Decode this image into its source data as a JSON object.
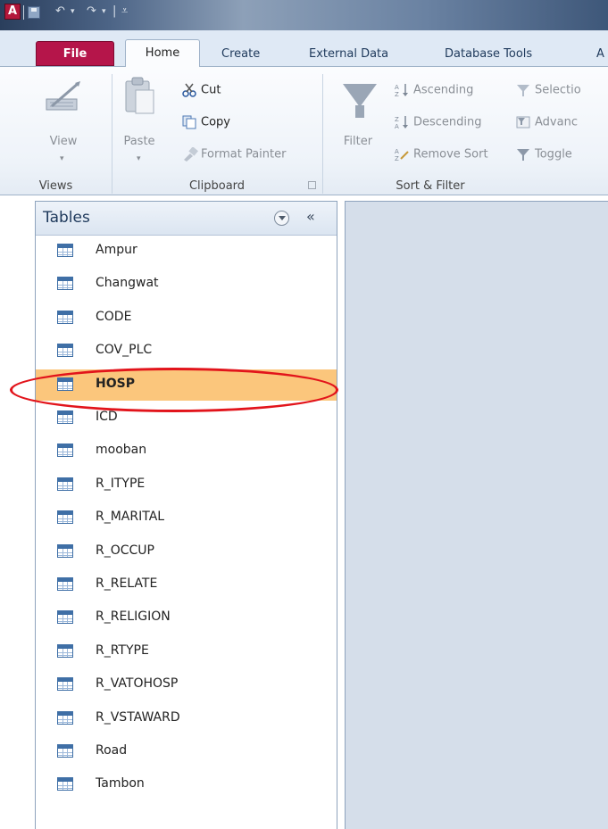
{
  "titlebar": {
    "app_logo": "A",
    "qat": [
      "↶",
      "▾",
      "↷",
      "▾",
      "|",
      "⩡"
    ]
  },
  "tabs": [
    {
      "id": "file",
      "label": "File"
    },
    {
      "id": "home",
      "label": "Home"
    },
    {
      "id": "create",
      "label": "Create"
    },
    {
      "id": "external",
      "label": "External Data"
    },
    {
      "id": "dbtools",
      "label": "Database Tools"
    },
    {
      "id": "more",
      "label": "A"
    }
  ],
  "ribbon": {
    "views": {
      "label": "Views",
      "view_button": "View"
    },
    "clipboard": {
      "label": "Clipboard",
      "paste": "Paste",
      "cut": "Cut",
      "copy": "Copy",
      "format_painter": "Format Painter"
    },
    "sort_filter": {
      "label": "Sort & Filter",
      "filter": "Filter",
      "ascending": "Ascending",
      "descending": "Descending",
      "remove_sort": "Remove Sort",
      "selection": "Selectio",
      "advanced": "Advanc",
      "toggle": "Toggle"
    }
  },
  "nav_pane": {
    "title": "Tables",
    "collapse_glyph": "«",
    "items": [
      "Ampur",
      "Changwat",
      "CODE",
      "COV_PLC",
      "HOSP",
      "ICD",
      "mooban",
      "R_ITYPE",
      "R_MARITAL",
      "R_OCCUP",
      "R_RELATE",
      "R_RELIGION",
      "R_RTYPE",
      "R_VATOHOSP",
      "R_VSTAWARD",
      "Road",
      "Tambon"
    ],
    "selected": "HOSP"
  },
  "colors": {
    "selection": "#fbc67c",
    "highlight_ring": "#e2141b",
    "file_tab": "#b5154a"
  }
}
